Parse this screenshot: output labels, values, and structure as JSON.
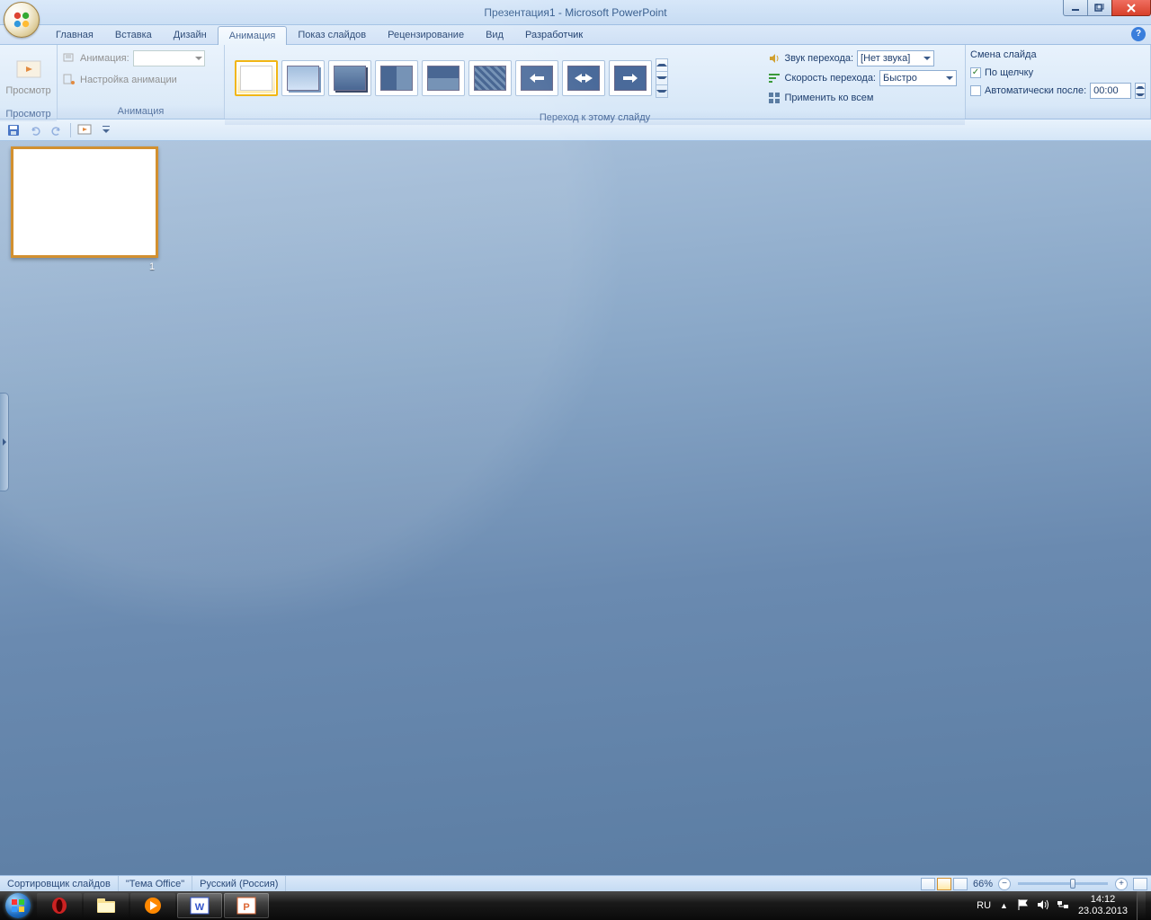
{
  "title": "Презентация1 - Microsoft PowerPoint",
  "tabs": [
    "Главная",
    "Вставка",
    "Дизайн",
    "Анимация",
    "Показ слайдов",
    "Рецензирование",
    "Вид",
    "Разработчик"
  ],
  "active_tab": "Анимация",
  "ribbon": {
    "preview": {
      "label": "Просмотр",
      "btn": "Просмотр"
    },
    "animation": {
      "label": "Анимация",
      "anim_label": "Анимация:",
      "settings": "Настройка анимации"
    },
    "transition": {
      "label": "Переход к этому слайду",
      "sound_label": "Звук перехода:",
      "sound_value": "[Нет звука]",
      "speed_label": "Скорость перехода:",
      "speed_value": "Быстро",
      "apply_all": "Применить ко всем"
    },
    "advance": {
      "label": "Смена слайда",
      "on_click": "По щелчку",
      "auto_after": "Автоматически после:",
      "time_value": "00:00"
    }
  },
  "slide_number": "1",
  "statusbar": {
    "mode": "Сортировщик слайдов",
    "theme": "\"Тема Office\"",
    "lang": "Русский (Россия)",
    "zoom": "66%"
  },
  "tray": {
    "lang": "RU",
    "time": "14:12",
    "date": "23.03.2013"
  }
}
